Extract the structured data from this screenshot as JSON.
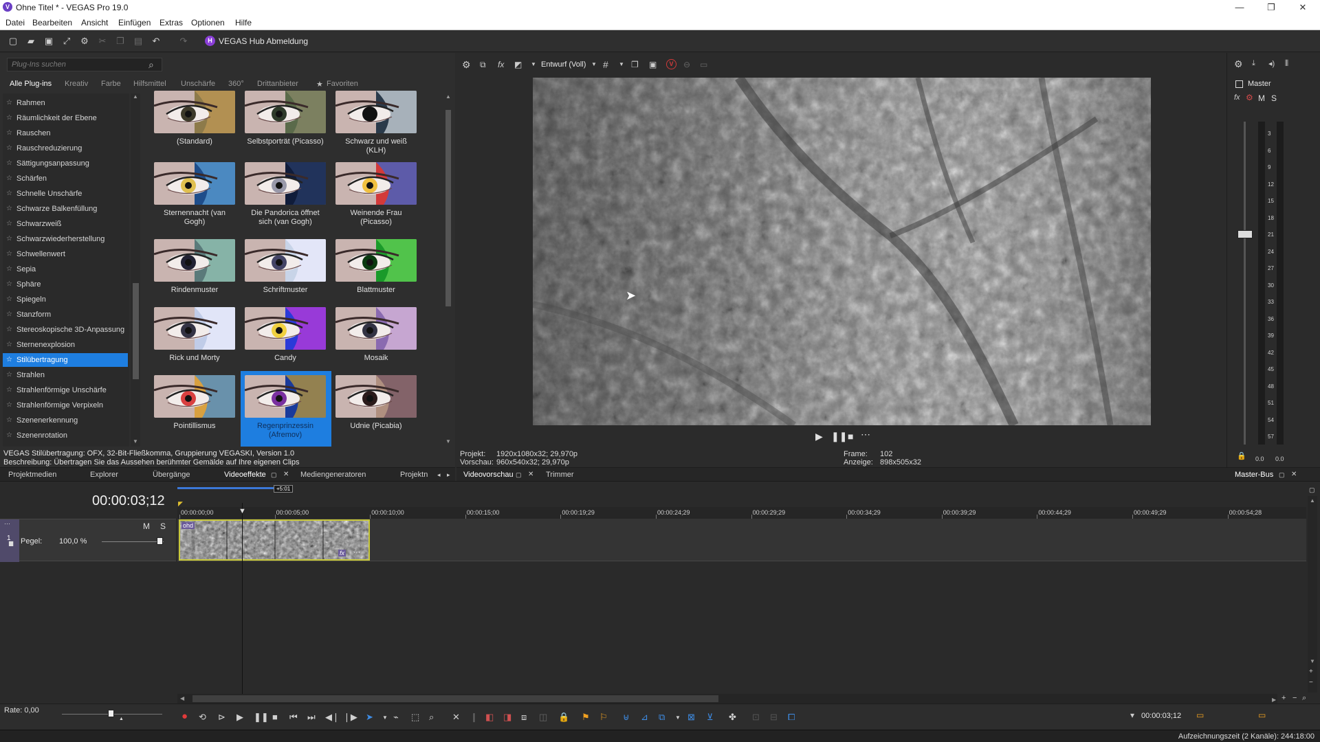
{
  "titlebar": {
    "logo_letter": "V",
    "title": "Ohne Titel * - VEGAS Pro 19.0",
    "minimize": "—",
    "restore": "❐",
    "close": "✕"
  },
  "menu": [
    "Datei",
    "Bearbeiten",
    "Ansicht",
    "Einfügen",
    "Extras",
    "Optionen",
    "Hilfe"
  ],
  "toolbar": {
    "hub_badge": "H",
    "hub_label": "VEGAS Hub Abmeldung"
  },
  "plugins": {
    "search_placeholder": "Plug-Ins suchen",
    "category_tabs": [
      "Alle Plug-ins",
      "Kreativ",
      "Farbe",
      "Hilfsmittel",
      "Unschärfe",
      "360°",
      "Drittanbieter",
      "Favoriten"
    ],
    "list": [
      "Rahmen",
      "Räumlichkeit der Ebene",
      "Rauschen",
      "Rauschreduzierung",
      "Sättigungsanpassung",
      "Schärfen",
      "Schnelle Unschärfe",
      "Schwarze Balkenfüllung",
      "Schwarzweiß",
      "Schwarzwiederherstellung",
      "Schwellenwert",
      "Sepia",
      "Sphäre",
      "Spiegeln",
      "Stanzform",
      "Stereoskopische 3D-Anpassung",
      "Sternenexplosion",
      "Stilübertragung",
      "Strahlen",
      "Strahlenförmige Unschärfe",
      "Strahlenförmige Verpixeln",
      "Szenenerkennung",
      "Szenenrotation"
    ],
    "selected_item": "Stilübertragung",
    "presets": [
      {
        "line1": "(Standard)",
        "line2": ""
      },
      {
        "line1": "Selbstporträt (Picasso)",
        "line2": ""
      },
      {
        "line1": "Schwarz und weiß",
        "line2": "(KLH)"
      },
      {
        "line1": "Sternennacht (van",
        "line2": "Gogh)"
      },
      {
        "line1": "Die Pandorica öffnet",
        "line2": "sich (van Gogh)"
      },
      {
        "line1": "Weinende Frau",
        "line2": "(Picasso)"
      },
      {
        "line1": "Rindenmuster",
        "line2": ""
      },
      {
        "line1": "Schriftmuster",
        "line2": ""
      },
      {
        "line1": "Blattmuster",
        "line2": ""
      },
      {
        "line1": "Rick und Morty",
        "line2": ""
      },
      {
        "line1": "Candy",
        "line2": ""
      },
      {
        "line1": "Mosaik",
        "line2": ""
      },
      {
        "line1": "Pointillismus",
        "line2": ""
      },
      {
        "line1": "Regenprinzessin",
        "line2": "(Afremov)"
      },
      {
        "line1": "Udnie (Picabia)",
        "line2": ""
      }
    ],
    "selected_preset": "Regenprinzessin",
    "description_line1": "VEGAS Stilübertragung: OFX, 32-Bit-Fließkomma, Gruppierung VEGASKI, Version 1.0",
    "description_line2": "Beschreibung: Übertragen Sie das Aussehen berühmter Gemälde auf Ihre eigenen Clips"
  },
  "left_tabs": [
    "Projektmedien",
    "Explorer",
    "Übergänge",
    "Videoeffekte",
    "Mediengeneratoren",
    "Projektn"
  ],
  "active_left_tab": "Videoeffekte",
  "preview": {
    "quality": "Entwurf (Voll)",
    "project_label": "Projekt:",
    "project_value": "1920x1080x32; 29,970p",
    "preview_label": "Vorschau:",
    "preview_value": "960x540x32; 29,970p",
    "frame_label": "Frame:",
    "frame_value": "102",
    "display_label": "Anzeige:",
    "display_value": "898x505x32",
    "tabs": [
      "Videovorschau",
      "Trimmer"
    ]
  },
  "master": {
    "label": "Master",
    "m": "M",
    "s": "S",
    "fx": "fx",
    "scale": [
      "3",
      "6",
      "9",
      "12",
      "15",
      "18",
      "21",
      "24",
      "27",
      "30",
      "33",
      "36",
      "39",
      "42",
      "45",
      "48",
      "51",
      "54",
      "57"
    ],
    "value_left": "0.0",
    "value_right": "0.0",
    "tab": "Master-Bus"
  },
  "timeline": {
    "timecode": "00:00:03;12",
    "badge": "+5:01",
    "ruler": [
      "00:00:00;00",
      "00:00:05;00",
      "00:00:10;00",
      "00:00:15;00",
      "00:00:19;29",
      "00:00:24;29",
      "00:00:29;29",
      "00:00:34;29",
      "00:00:39;29",
      "00:00:44;29",
      "00:00:49;29",
      "00:00:54;28"
    ],
    "track_number": "1",
    "track_m": "M",
    "track_s": "S",
    "level_label": "Pegel:",
    "level_value": "100,0 %",
    "clip_label": "ohd",
    "clip_fx": "fx"
  },
  "bottom": {
    "rate": "Rate: 0,00",
    "timecode": "00:00:03;12",
    "status": "Aufzeichnungszeit (2 Kanäle): 244:18:00"
  }
}
